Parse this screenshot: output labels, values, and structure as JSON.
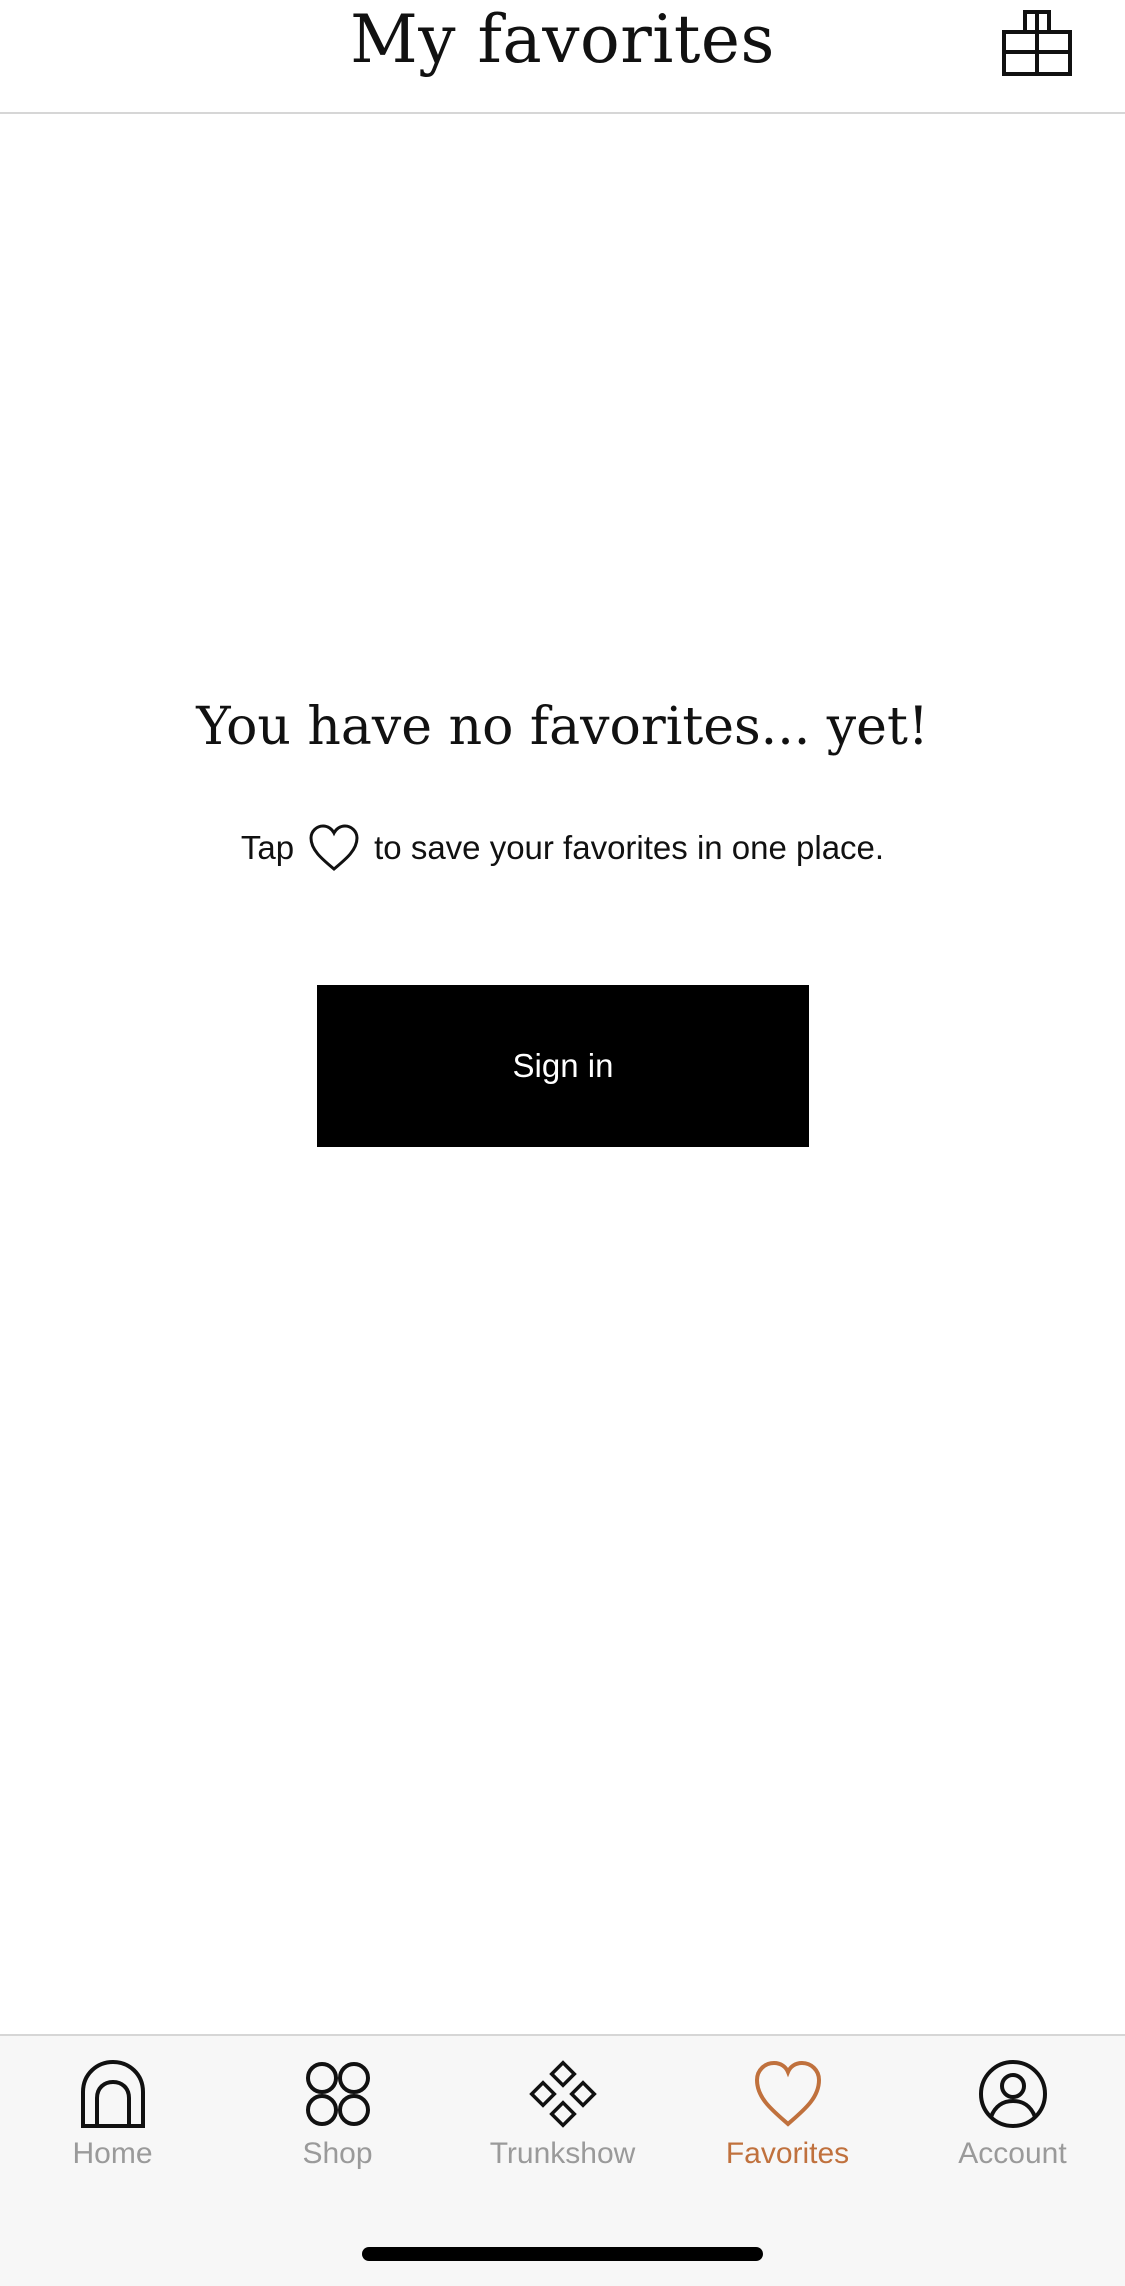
{
  "header": {
    "title": "My favorites",
    "bag_icon": "shopping-bag-icon"
  },
  "empty_state": {
    "title": "You have no favorites... yet!",
    "hint_before": "Tap",
    "hint_icon": "heart-icon",
    "hint_after": "to save your favorites in one place.",
    "signin_label": "Sign in"
  },
  "tabbar": {
    "active_color": "#c0713d",
    "inactive_color": "#9a9a9a",
    "items": [
      {
        "label": "Home",
        "icon": "home-icon",
        "active": false
      },
      {
        "label": "Shop",
        "icon": "grid-circles-icon",
        "active": false
      },
      {
        "label": "Trunkshow",
        "icon": "diamond-icon",
        "active": false
      },
      {
        "label": "Favorites",
        "icon": "heart-icon",
        "active": true
      },
      {
        "label": "Account",
        "icon": "account-icon",
        "active": false
      }
    ]
  }
}
